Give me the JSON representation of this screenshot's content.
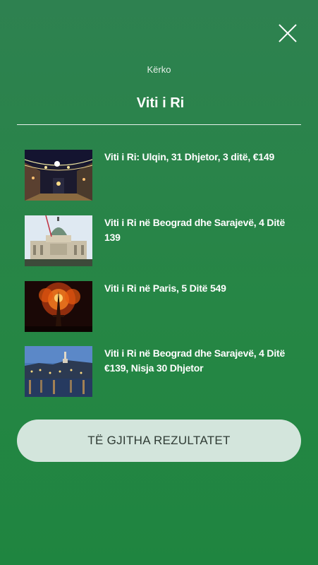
{
  "search": {
    "label": "Kërko",
    "value": "Viti i Ri"
  },
  "results": [
    {
      "title": "Viti i Ri: Ulqin, 31 Dhjetor, 3 ditë, €149",
      "image": "street-lights-photo"
    },
    {
      "title": "Viti i Ri në Beograd dhe Sarajevë, 4 Ditë 139",
      "image": "parliament-building-photo"
    },
    {
      "title": "Viti i Ri në Paris, 5 Ditë 549",
      "image": "eiffel-fireworks-photo"
    },
    {
      "title": "Viti i Ri në Beograd dhe Sarajevë, 4 Ditë €139, Nisja 30 Dhjetor",
      "image": "belgrade-night-photo"
    }
  ],
  "all_results_button": "TË GJITHA REZULTATET",
  "icons": {
    "close": "close-icon"
  }
}
